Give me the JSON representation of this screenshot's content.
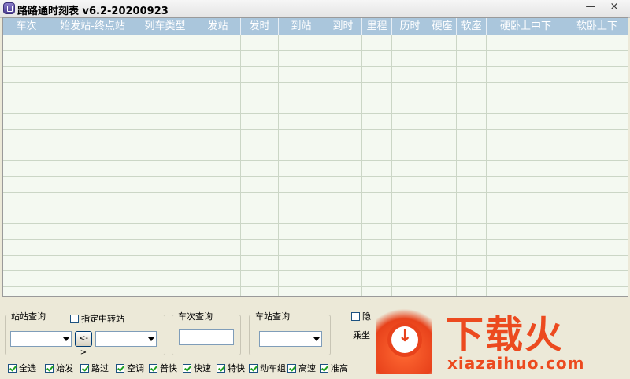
{
  "window": {
    "title": "路路通时刻表 v6.2-20200923",
    "minimize": "—",
    "close": "×"
  },
  "table": {
    "columns": [
      "车次",
      "始发站-终点站",
      "列车类型",
      "发站",
      "发时",
      "到站",
      "到时",
      "里程",
      "历时",
      "硬座",
      "软座",
      "硬卧上中下",
      "软卧上下"
    ]
  },
  "panel": {
    "station_query": {
      "title": "站站查询",
      "transfer_label": "指定中转站",
      "swap_label": "<->"
    },
    "train_query": {
      "title": "车次查询"
    },
    "station_lookup": {
      "title": "车站查询"
    },
    "partial": {
      "hide_label": "隐",
      "ride_label": "乘坐"
    },
    "filters": [
      {
        "label": "全选",
        "checked": true
      },
      {
        "label": "始发",
        "checked": true
      },
      {
        "label": "路过",
        "checked": true
      },
      {
        "label": "空调",
        "checked": true
      },
      {
        "label": "普快",
        "checked": true
      },
      {
        "label": "快速",
        "checked": true
      },
      {
        "label": "特快",
        "checked": true
      },
      {
        "label": "动车组",
        "checked": true
      },
      {
        "label": "高速",
        "checked": true
      },
      {
        "label": "准高",
        "checked": true
      }
    ]
  },
  "watermark": {
    "brand": "下载火",
    "url": "xiazaihuo.com"
  },
  "colors": {
    "header": "#aac6dc",
    "grid_bg": "#f4f9f1",
    "window_bg": "#ece9d8",
    "watermark": "#ec4a1f"
  }
}
